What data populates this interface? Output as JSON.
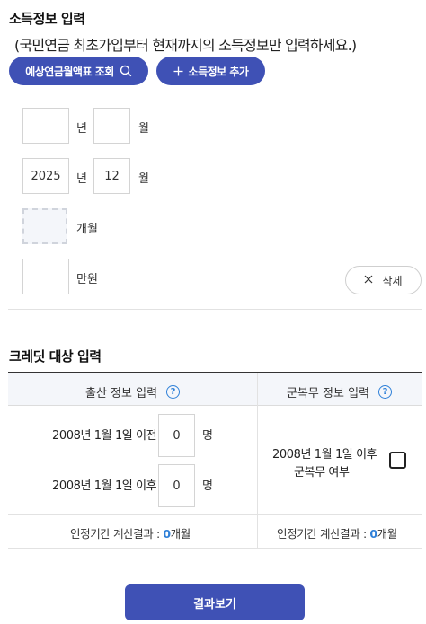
{
  "income_section": {
    "title": "소득정보 입력",
    "subtitle": "(국민연금 최초가입부터 현재까지의 소득정보만 입력하세요.)",
    "lookup_button": "예상연금월액표 조회",
    "add_button": "소득정보 추가",
    "start_year_value": "",
    "start_month_value": "",
    "end_year_value": "2025",
    "end_month_value": "12",
    "year_unit": "년",
    "month_unit": "월",
    "months_value": "",
    "months_unit": "개월",
    "income_value": "",
    "income_unit": "만원",
    "delete_button": "삭제"
  },
  "credit_section": {
    "title": "크레딧 대상 입력",
    "birth_header": "출산 정보 입력",
    "military_header": "군복무 정보 입력",
    "help_glyph": "?",
    "birth_before_label": "2008년 1월 1일 이전",
    "birth_before_value": "0",
    "birth_after_label": "2008년 1월 1일 이후",
    "birth_after_value": "0",
    "person_unit": "명",
    "military_label_line1": "2008년 1월 1일 이후",
    "military_label_line2": "군복무 여부",
    "military_checked": false,
    "birth_result_prefix": "인정기간 계산결과 : ",
    "birth_result_value": "0",
    "birth_result_unit": "개월",
    "military_result_prefix": "인정기간 계산결과 : ",
    "military_result_value": "0",
    "military_result_unit": "개월"
  },
  "submit_button": "결과보기",
  "colors": {
    "primary": "#3f51b5",
    "accent_blue": "#2f80d8",
    "header_bg": "#f4f6fa"
  }
}
